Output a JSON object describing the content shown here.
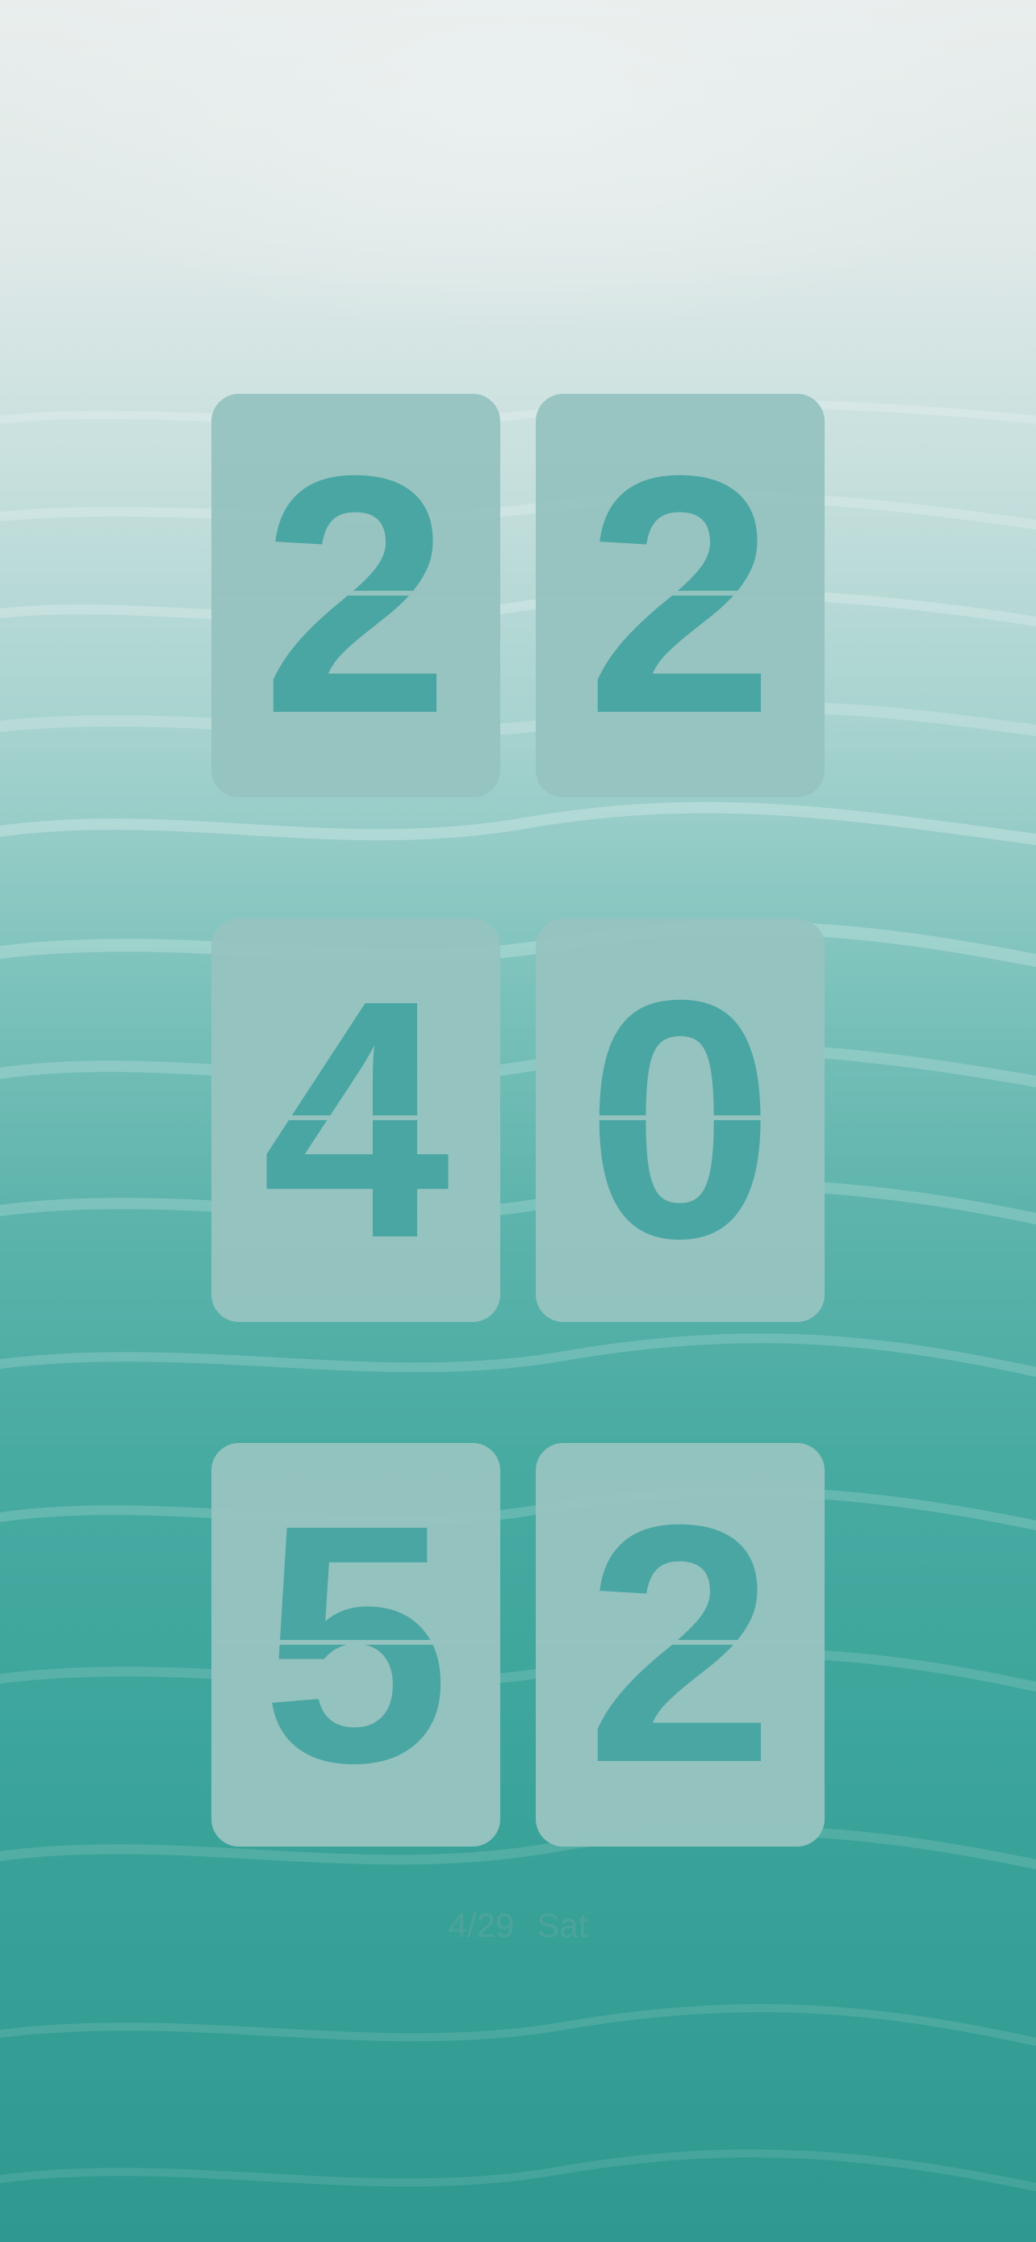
{
  "clock": {
    "hours": [
      "2",
      "2"
    ],
    "minutes": [
      "4",
      "0"
    ],
    "seconds": [
      "5",
      "2"
    ]
  },
  "date": {
    "day_month": "4/29",
    "weekday": "Sat"
  },
  "colors": {
    "tile_background": "#96c3c0",
    "digit": "#4aa6a3",
    "water_top": "#e9eeed",
    "water_bottom": "#2f998f"
  }
}
